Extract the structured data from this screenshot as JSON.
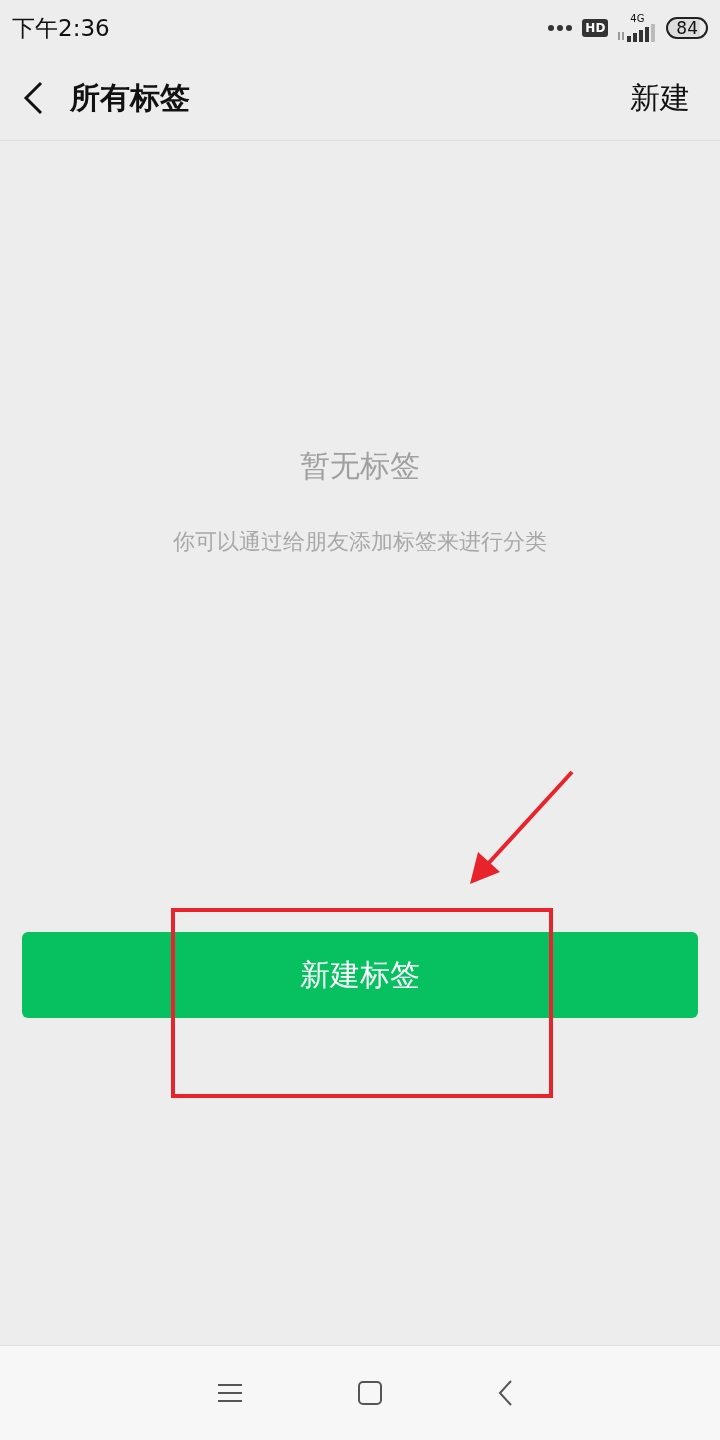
{
  "status_bar": {
    "time": "下午2:36",
    "hd_badge": "HD",
    "network": "4G",
    "battery": "84"
  },
  "header": {
    "title": "所有标签",
    "action": "新建"
  },
  "empty_state": {
    "title": "暂无标签",
    "message": "你可以通过给朋友添加标签来进行分类"
  },
  "primary_button": {
    "label": "新建标签"
  },
  "annotations": {
    "arrow": true,
    "highlight_box": true
  }
}
